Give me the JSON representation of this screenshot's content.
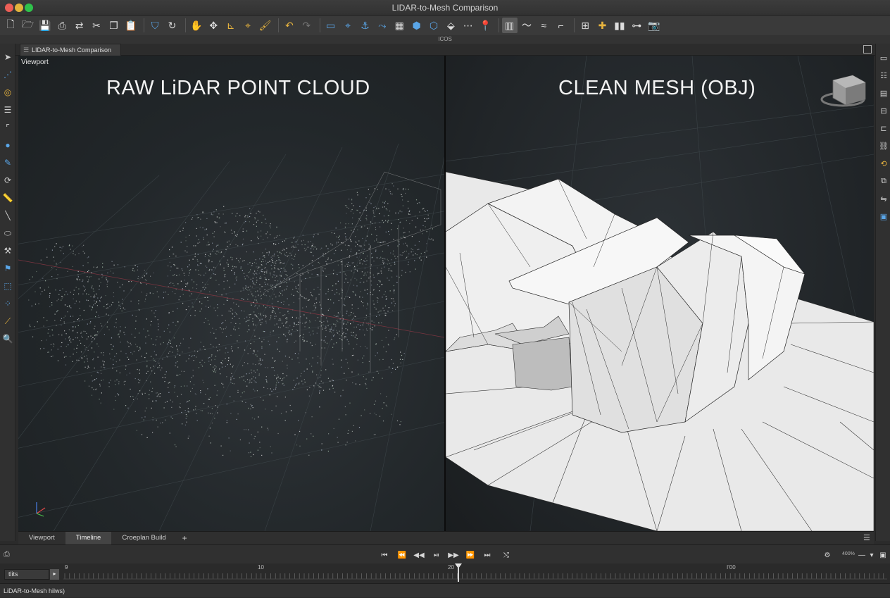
{
  "window": {
    "title": "LIDAR-to-Mesh Comparison"
  },
  "toolbar": {
    "sub_label": "ICOS"
  },
  "document_tab": {
    "label": "LIDAR-to-Mesh Comparison"
  },
  "viewport": {
    "label": "Viewport",
    "left_heading": "RAW LiDAR POINT CLOUD",
    "right_heading": "CLEAN MESH (OBJ)"
  },
  "bottom_tabs": [
    {
      "label": "Viewport",
      "active": false
    },
    {
      "label": "Timeline",
      "active": true
    },
    {
      "label": "Croeplan Build",
      "active": false
    }
  ],
  "bottom_add_label": "+",
  "transport": {
    "zoom_label": "400%"
  },
  "timeline": {
    "field_value": "tlits",
    "ticks": [
      "9",
      "10",
      "20",
      "I'00"
    ],
    "playhead_value": 20.5
  },
  "status": {
    "text": "LiDAR-to-Mesh hilws)"
  },
  "colors": {
    "background": "#2b2b2b",
    "toolbar": "#3a3a3a",
    "accent_blue": "#5aa6e8",
    "accent_yellow": "#e6b33e"
  }
}
